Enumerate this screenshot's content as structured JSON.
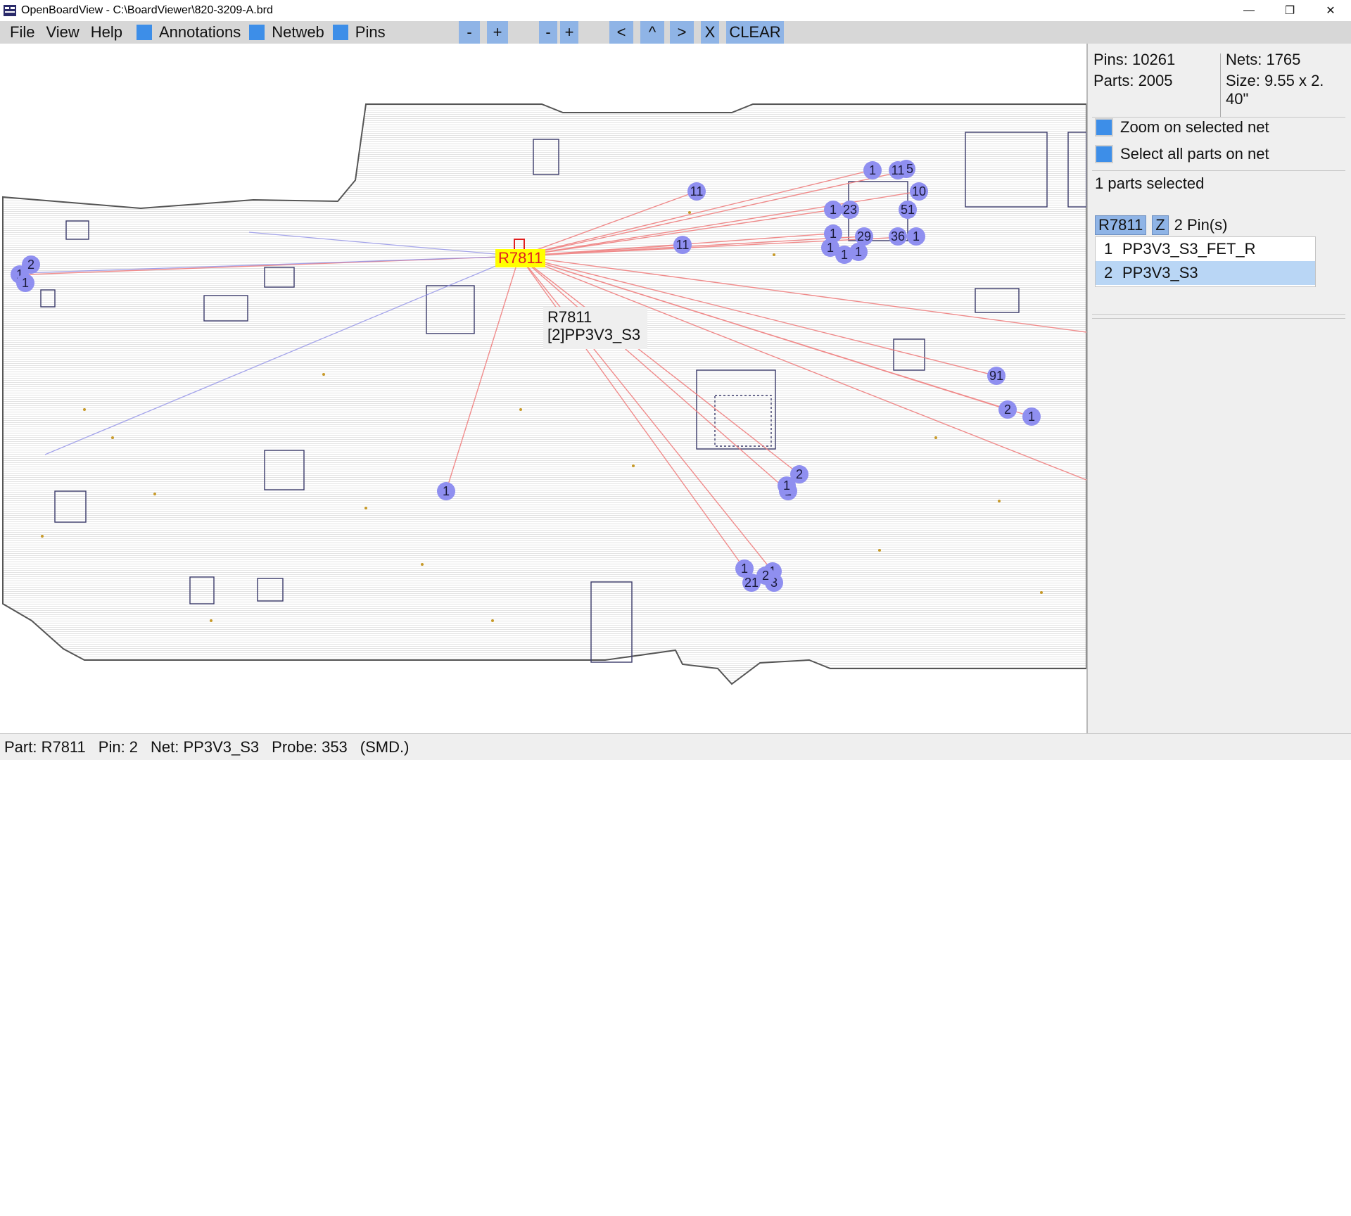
{
  "window": {
    "title": "OpenBoardView - C:\\BoardViewer\\820-3209-A.brd",
    "minimize_glyph": "—",
    "restore_glyph": "❐",
    "close_glyph": "✕"
  },
  "menu": {
    "file": "File",
    "view": "View",
    "help": "Help"
  },
  "toggles": {
    "annotations": "Annotations",
    "netweb": "Netweb",
    "pins": "Pins"
  },
  "toolbar_buttons": {
    "zoom_out": "-",
    "zoom_in": "+",
    "scale_down": "-",
    "scale_up": "+",
    "prev": "<",
    "up": "^",
    "next": ">",
    "x": "X",
    "clear": "CLEAR"
  },
  "board_info": {
    "pins": "Pins: 10261",
    "parts": "Parts: 2005",
    "nets": "Nets: 1765",
    "size": "Size: 9.55 x 2.\n40\""
  },
  "options": {
    "zoom_on_net": "Zoom on selected net",
    "select_all_on_net": "Select all parts on net"
  },
  "selection": {
    "count_text": "1 parts selected",
    "part_name": "R7811",
    "zoom_tag": "Z",
    "pin_count": "2 Pin(s)",
    "pins": [
      {
        "num": "1",
        "net": "PP3V3_S3_FET_R"
      },
      {
        "num": "2",
        "net": "PP3V3_S3"
      }
    ]
  },
  "board_labels": {
    "highlight_part": "R7811",
    "tooltip_line1": "R7811",
    "tooltip_line2": "[2]PP3V3_S3",
    "pin_markers": [
      "1",
      "2",
      "1",
      "1",
      "11",
      "11",
      "1",
      "15",
      "10",
      "11",
      "1",
      "1",
      "23",
      "51",
      "1",
      "29",
      "36",
      "1",
      "1",
      "1",
      "91",
      "2",
      "1",
      "2",
      "1",
      "1",
      "1",
      "21",
      "1",
      "3",
      "2"
    ]
  },
  "status": {
    "part": "Part: R7811",
    "pin": "Pin: 2",
    "net": "Net: PP3V3_S3",
    "probe": "Probe: 353",
    "type": "(SMD.)"
  },
  "colors": {
    "toolbar_bg": "#d7d7d7",
    "button_bg": "#8fb4e6",
    "checkbox": "#3d8ee8",
    "netweb_line": "#f08080",
    "pin_marker": "#8f8ff0",
    "outline": "#555555"
  }
}
